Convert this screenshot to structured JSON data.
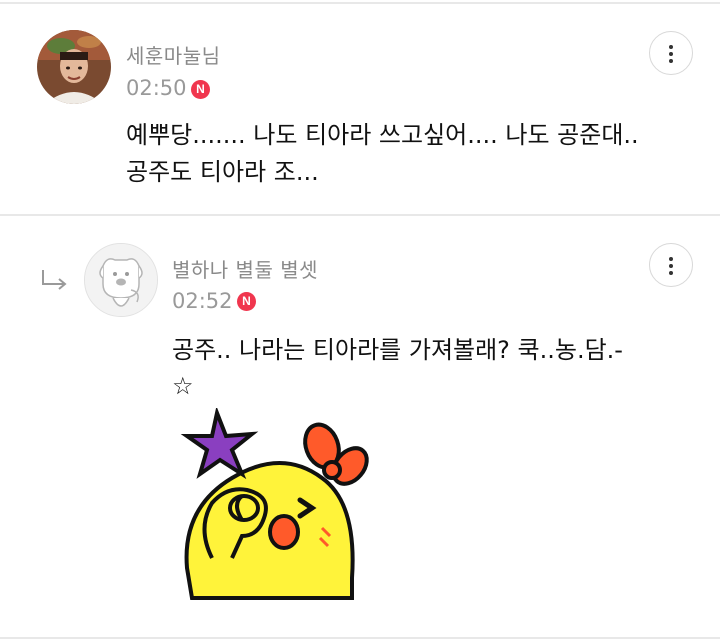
{
  "comments": [
    {
      "author": "세훈마눌님",
      "time": "02:50",
      "badge": "N",
      "text_lines": [
        "예뿌당....... 나도 티아라 쓰고싶어.... 나도 공준대..",
        "공주도 티아라 조..."
      ]
    },
    {
      "author": "별하나 별둘 별셋",
      "time": "02:52",
      "badge": "N",
      "text_lines": [
        "공주.. 나라는 티아라를 가져볼래? 쿡..농.담.-",
        "☆"
      ],
      "is_reply": true,
      "sticker": "yellow-chick-wink-sticker"
    }
  ],
  "colors": {
    "badge": "#f0364e",
    "divider": "#e8e8e8",
    "author": "#8a8a8a"
  }
}
